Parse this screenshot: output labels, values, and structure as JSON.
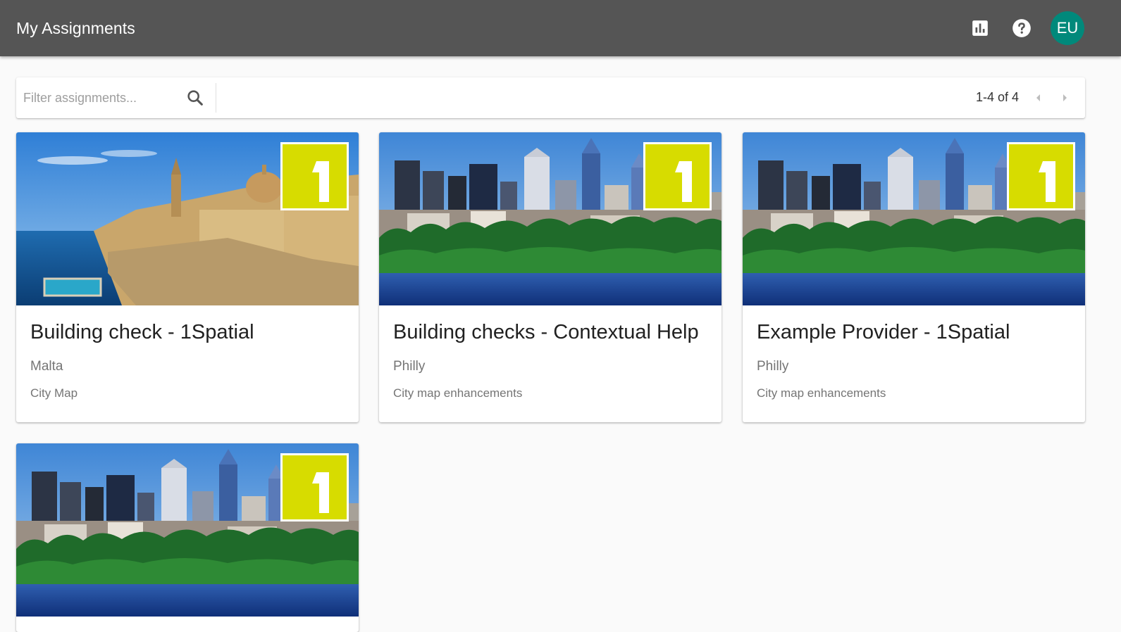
{
  "header": {
    "title": "My Assignments",
    "user_initials": "EU",
    "avatar_color": "#00897b",
    "bar_color": "#555555",
    "icons": [
      "chart-icon",
      "help-icon"
    ]
  },
  "filter": {
    "placeholder": "Filter assignments...",
    "value": "",
    "range_label": "1-4 of 4"
  },
  "brand": {
    "logo_digit": "1",
    "logo_color": "#d7dc00"
  },
  "cards": [
    {
      "name": "Building check - 1Spatial",
      "region": "Malta",
      "project": "City Map",
      "image": "malta-coast"
    },
    {
      "name": "Building checks - Contextual Help",
      "region": "Philly",
      "project": "City map enhancements",
      "image": "philly-skyline"
    },
    {
      "name": "Example Provider - 1Spatial",
      "region": "Philly",
      "project": "City map enhancements",
      "image": "philly-skyline"
    },
    {
      "name": "",
      "region": "",
      "project": "",
      "image": "philly-skyline"
    }
  ]
}
